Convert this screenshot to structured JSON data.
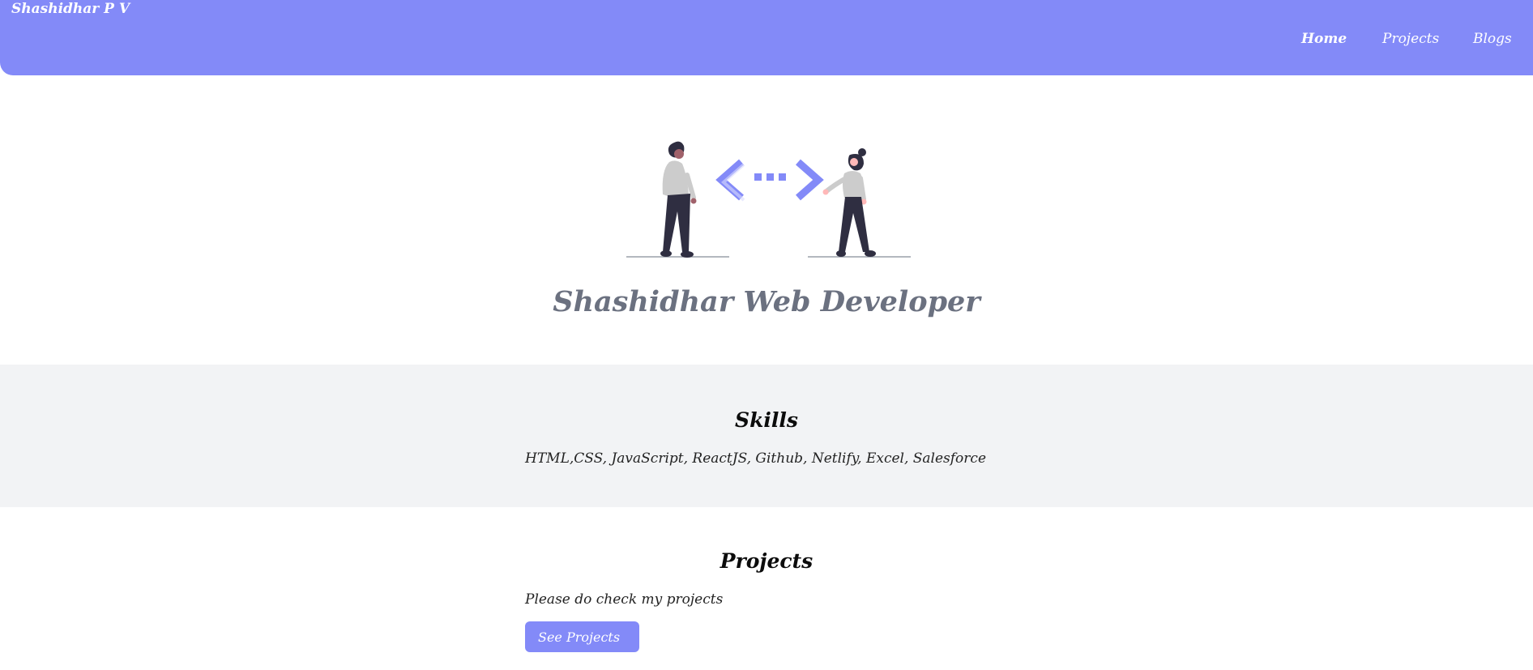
{
  "navbar": {
    "brand": "Shashidhar P V",
    "links": [
      {
        "label": "Home",
        "active": true
      },
      {
        "label": "Projects",
        "active": false
      },
      {
        "label": "Blogs",
        "active": false
      }
    ]
  },
  "hero": {
    "illustration": "two-people-code-exchange-illustration",
    "title": "Shashidhar Web Developer"
  },
  "skills": {
    "heading": "Skills",
    "text": "HTML,CSS, JavaScript, ReactJS, Github, Netlify, Excel, Salesforce"
  },
  "projects": {
    "heading": "Projects",
    "text": "Please do check my projects",
    "button_label": "See Projects"
  },
  "colors": {
    "accent": "#838af8",
    "hero_title": "#6b7180",
    "skills_background": "#f2f3f5"
  }
}
